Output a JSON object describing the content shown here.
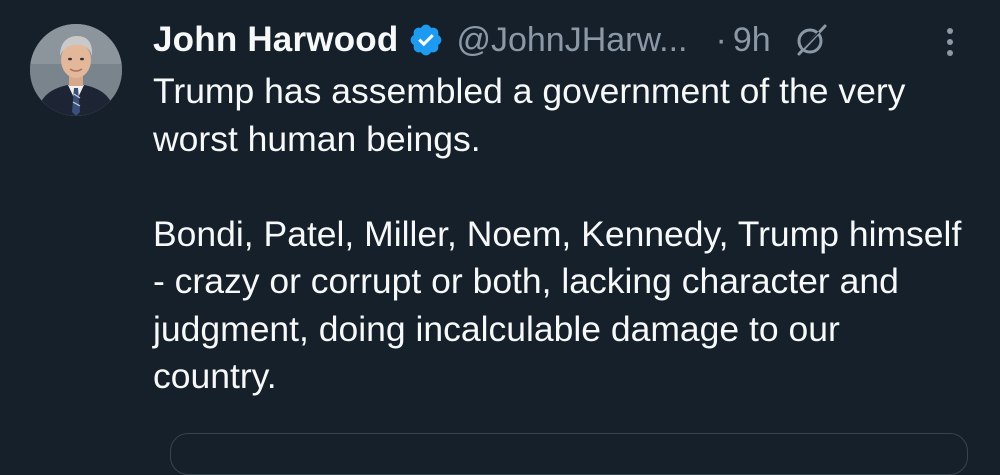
{
  "tweet": {
    "author": {
      "name": "John Harwood",
      "handle": "@JohnJHarw...",
      "verified_icon": "verified-badge-icon",
      "avatar": "author-avatar"
    },
    "separator": "·",
    "time": "9h",
    "grok_icon": "grok-icon",
    "more_icon": "more-options-icon",
    "paragraphs": [
      "Trump has assembled a government of the very worst human beings.",
      "Bondi, Patel, Miller, Noem, Kennedy, Trump himself - crazy or corrupt or both, lacking character and judgment, doing incalculable damage to our country."
    ]
  },
  "colors": {
    "background": "#15202b",
    "text_primary": "#f7f9f9",
    "text_secondary": "#8b98a5",
    "verified_blue": "#1d9bf0",
    "border": "#38444d"
  }
}
